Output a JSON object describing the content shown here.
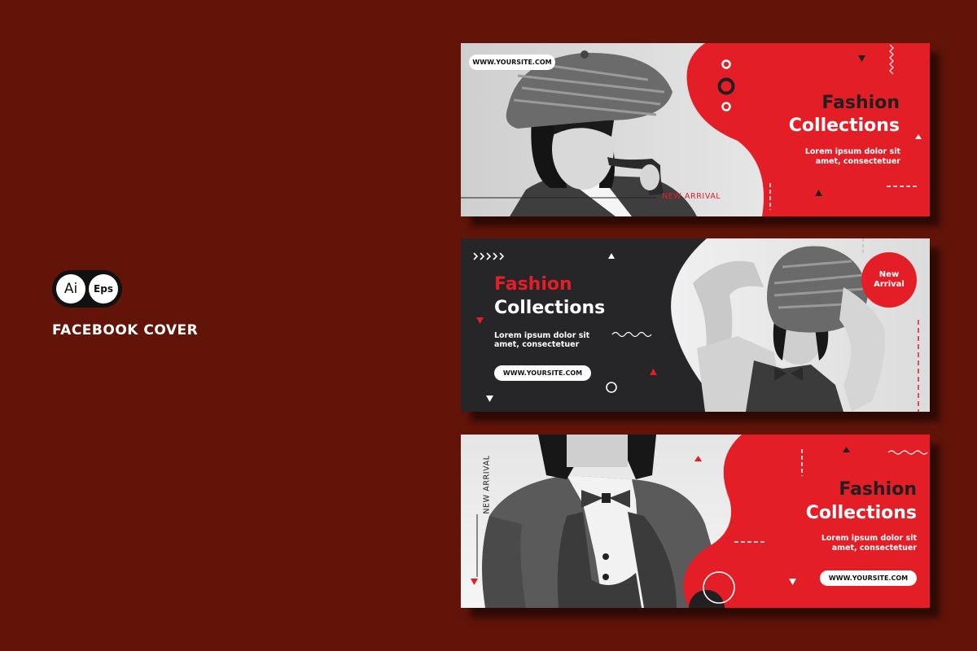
{
  "badge": {
    "ai": "Ai",
    "eps": "Eps"
  },
  "label": "FACEBOOK COVER",
  "colors": {
    "background": "#621409",
    "accent_red": "#e31e26",
    "dark": "#262527",
    "text_dark": "#231f20"
  },
  "cover1": {
    "url": "WWW.YOURSITE.COM",
    "title_line1": "Fashion",
    "title_line2": "Collections",
    "subtitle_line1": "Lorem ipsum dolor sit",
    "subtitle_line2": "amet, consectetuer",
    "tagline": "NEW ARRIVAL"
  },
  "cover2": {
    "title_line1": "Fashion",
    "title_line2": "Collections",
    "subtitle_line1": "Lorem ipsum dolor sit",
    "subtitle_line2": "amet, consectetuer",
    "url": "WWW.YOURSITE.COM",
    "badge_line1": "New",
    "badge_line2": "Arrival"
  },
  "cover3": {
    "tagline": "NEW ARRIVAL",
    "title_line1": "Fashion",
    "title_line2": "Collections",
    "subtitle_line1": "Lorem ipsum dolor sit",
    "subtitle_line2": "amet, consectetuer",
    "url": "WWW.YOURSITE.COM"
  }
}
